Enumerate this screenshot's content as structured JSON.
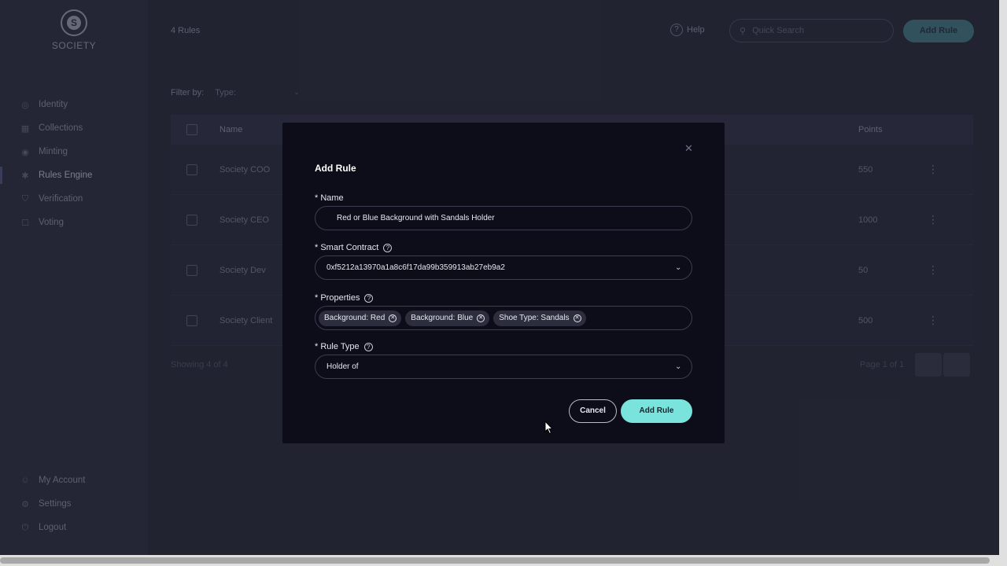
{
  "brand": {
    "name": "SOCIETY",
    "mark": "S"
  },
  "sidebar": {
    "items": [
      {
        "label": "Identity",
        "icon": "fingerprint-icon"
      },
      {
        "label": "Collections",
        "icon": "grid-icon"
      },
      {
        "label": "Minting",
        "icon": "coin-icon"
      },
      {
        "label": "Rules Engine",
        "icon": "gear-icon"
      },
      {
        "label": "Verification",
        "icon": "shield-icon"
      },
      {
        "label": "Voting",
        "icon": "vote-icon"
      }
    ],
    "bottom": [
      {
        "label": "My Account",
        "icon": "user-icon"
      },
      {
        "label": "Settings",
        "icon": "settings-icon"
      },
      {
        "label": "Logout",
        "icon": "logout-icon"
      }
    ]
  },
  "header": {
    "count": "4 Rules",
    "help": "Help",
    "search_placeholder": "Quick Search",
    "add_rule": "Add Rule"
  },
  "filter": {
    "label": "Filter by:",
    "type": "Type:"
  },
  "table": {
    "columns": {
      "name": "Name",
      "points": "Points"
    },
    "rows": [
      {
        "name": "Society COO",
        "points": "550"
      },
      {
        "name": "Society CEO",
        "points": "1000"
      },
      {
        "name": "Society Dev",
        "points": "50"
      },
      {
        "name": "Society Client",
        "points": "500"
      }
    ],
    "showing": "Showing 4 of 4",
    "page": "Page 1 of 1"
  },
  "modal": {
    "title": "Add Rule",
    "name_label": "* Name",
    "name_value": "Red or Blue Background with Sandals Holder",
    "contract_label": "* Smart Contract",
    "contract_value": "0xf5212a13970a1a8c6f17da99b359913ab27eb9a2",
    "properties_label": "* Properties",
    "properties": [
      "Background: Red",
      "Background: Blue",
      "Shoe Type: Sandals"
    ],
    "rule_type_label": "* Rule Type",
    "rule_type_value": "Holder of",
    "cancel": "Cancel",
    "submit": "Add Rule"
  },
  "colors": {
    "accent": "#79e3dc",
    "modal_bg": "#0c0d18",
    "page_bg": "#282a3a"
  }
}
